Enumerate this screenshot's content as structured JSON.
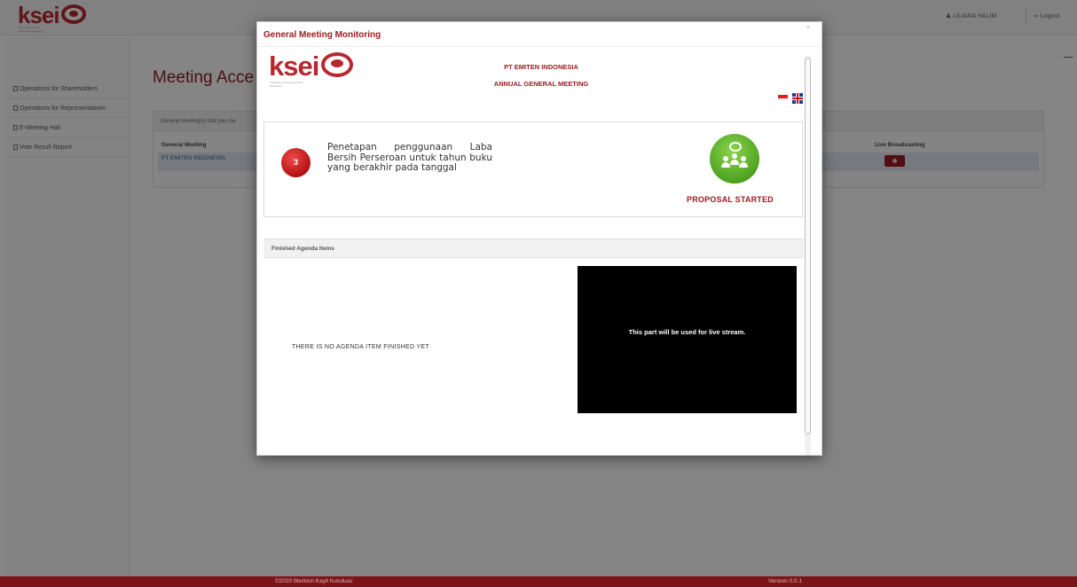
{
  "header": {
    "logo_text": "ksei",
    "logo_subtitle": "Indonesia Central Securities Depository",
    "user_name": "LILIANA HALIM",
    "logout_label": "Logout"
  },
  "sidebar": {
    "items": [
      {
        "label": "Operations for Shareholders"
      },
      {
        "label": "Operations for Representatives"
      },
      {
        "label": "E-Meeting Hall"
      },
      {
        "label": "Vote Result Report"
      }
    ]
  },
  "main": {
    "title": "Meeting Acce",
    "panel_header": "General meeting(s) that you ma",
    "columns": {
      "general_meeting": "General Meeting",
      "live_broadcasting": "Live Broadcasting"
    },
    "rows": [
      {
        "general_meeting": "PT EMITEN INDONESIA"
      }
    ]
  },
  "modal": {
    "title": "General Meeting Monitoring",
    "close": "×",
    "company_name": "PT EMITEN INDONESIA",
    "meeting_type": "ANNUAL GENERAL MEETING",
    "agenda": {
      "number": "3",
      "text": "Penetapan penggunaan Laba Bersih Perseroan untuk tahun buku yang berakhir pada tanggal",
      "status": "PROPOSAL STARTED"
    },
    "finished_header": "Finished Agenda Items",
    "finished_empty": "THERE IS NO AGENDA ITEM FINISHED YET",
    "stream_text": "This part will be used for live stream."
  },
  "footer": {
    "copyright": "©2020 Merkezi Kayit Kurulusu",
    "version": "Version 0.0.1"
  },
  "colors": {
    "brand_red": "#9b1c22",
    "status_green": "#49a01d",
    "footer_bg": "#7c1519"
  }
}
